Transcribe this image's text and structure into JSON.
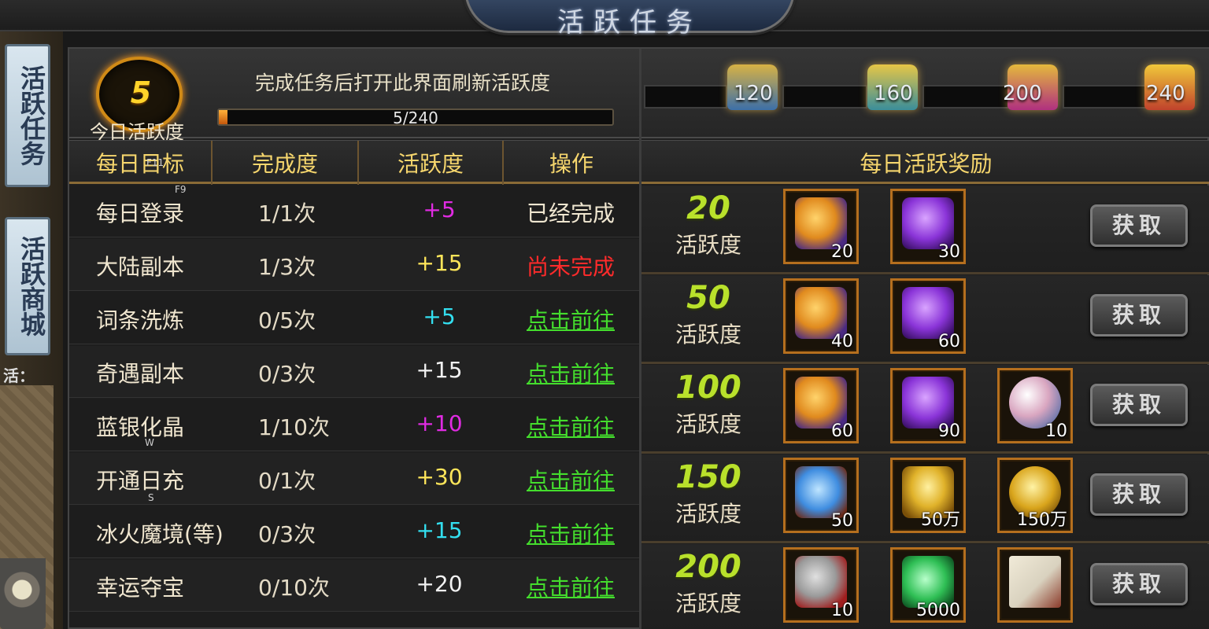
{
  "title": "活跃任务",
  "side_tabs": [
    {
      "label": "活跃任务"
    },
    {
      "label": "活跃商城"
    }
  ],
  "side_short_label": "活：",
  "header": {
    "today_activity_value": "5",
    "today_activity_label": "今日活跃度",
    "refresh_hint": "完成任务后打开此界面刷新活跃度",
    "progress_text": "5/240",
    "progress_fraction": 0.021,
    "milestones": [
      "120",
      "160",
      "200",
      "240"
    ]
  },
  "columns": {
    "goal": "每日目标",
    "progress": "完成度",
    "points": "活跃度",
    "action": "操作",
    "rewards": "每日活跃奖励"
  },
  "hotkey_hints": {
    "f11": "F11",
    "f9": "F9",
    "w": "W",
    "s": "S"
  },
  "tasks": [
    {
      "name": "每日登录",
      "progress": "1/1次",
      "points": "+5",
      "points_color": "#e12be3",
      "action": "已经完成",
      "action_type": "done"
    },
    {
      "name": "大陆副本",
      "progress": "1/3次",
      "points": "+15",
      "points_color": "#ffe65a",
      "action": "尚未完成",
      "action_type": "undone"
    },
    {
      "name": "词条洗炼",
      "progress": "0/5次",
      "points": "+5",
      "points_color": "#33dff0",
      "action": "点击前往",
      "action_type": "go"
    },
    {
      "name": "奇遇副本",
      "progress": "0/3次",
      "points": "+15",
      "points_color": "#f2f2f2",
      "action": "点击前往",
      "action_type": "go"
    },
    {
      "name": "蓝银化晶",
      "progress": "1/10次",
      "points": "+10",
      "points_color": "#e12be3",
      "action": "点击前往",
      "action_type": "go"
    },
    {
      "name": "开通日充",
      "progress": "0/1次",
      "points": "+30",
      "points_color": "#ffe65a",
      "action": "点击前往",
      "action_type": "go"
    },
    {
      "name": "冰火魔境(等)",
      "progress": "0/3次",
      "points": "+15",
      "points_color": "#33dff0",
      "action": "点击前往",
      "action_type": "go"
    },
    {
      "name": "幸运夺宝",
      "progress": "0/10次",
      "points": "+20",
      "points_color": "#f2f2f2",
      "action": "点击前往",
      "action_type": "go"
    }
  ],
  "rewards": [
    {
      "threshold": "20",
      "label": "活跃度",
      "button": "获取",
      "items": [
        {
          "icon": "orange-crystal-icon",
          "qty": "20",
          "color": "#e08a1e"
        },
        {
          "icon": "purple-crystal-icon",
          "qty": "30",
          "color": "#8a34d8"
        }
      ]
    },
    {
      "threshold": "50",
      "label": "活跃度",
      "button": "获取",
      "items": [
        {
          "icon": "orange-crystal-icon",
          "qty": "40",
          "color": "#e08a1e"
        },
        {
          "icon": "purple-crystal-icon",
          "qty": "60",
          "color": "#8a34d8"
        }
      ]
    },
    {
      "threshold": "100",
      "label": "活跃度",
      "button": "获取",
      "items": [
        {
          "icon": "orange-crystal-icon",
          "qty": "60",
          "color": "#e08a1e"
        },
        {
          "icon": "purple-crystal-icon",
          "qty": "90",
          "color": "#8a34d8"
        },
        {
          "icon": "pearl-stone-icon",
          "qty": "10",
          "color": "#d9a6c0"
        }
      ]
    },
    {
      "threshold": "150",
      "label": "活跃度",
      "button": "获取",
      "items": [
        {
          "icon": "blue-crystal-icon",
          "qty": "50",
          "color": "#3f8de0"
        },
        {
          "icon": "gold-ingot-icon",
          "qty": "50万",
          "color": "#e0b22a"
        },
        {
          "icon": "gold-coin-icon",
          "qty": "150万",
          "color": "#d9a51c"
        }
      ]
    },
    {
      "threshold": "200",
      "label": "活跃度",
      "button": "获取",
      "items": [
        {
          "icon": "rune-stone-icon",
          "qty": "10",
          "color": "#9a9a9a"
        },
        {
          "icon": "green-jade-icon",
          "qty": "5000",
          "color": "#2fbf55"
        },
        {
          "icon": "scroll-icon",
          "qty": "",
          "color": "#d9d2bf"
        }
      ]
    }
  ]
}
